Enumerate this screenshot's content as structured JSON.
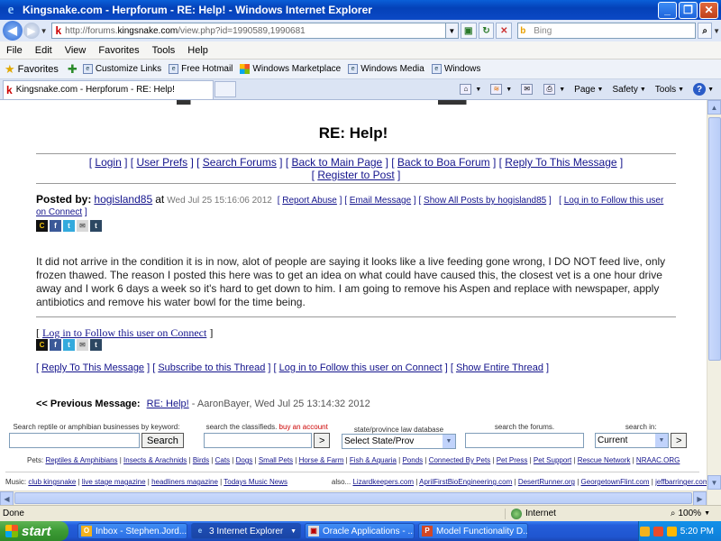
{
  "window": {
    "title": "Kingsnake.com - Herpforum - RE: Help! - Windows Internet Explorer"
  },
  "address": {
    "prefix": "http://forums.",
    "domain": "kingsnake.com",
    "path": "/view.php?id=1990589,1990681"
  },
  "search": {
    "placeholder": "Bing"
  },
  "menu": [
    "File",
    "Edit",
    "View",
    "Favorites",
    "Tools",
    "Help"
  ],
  "favorites": {
    "label": "Favorites",
    "links": [
      "Customize Links",
      "Free Hotmail",
      "Windows Marketplace",
      "Windows Media",
      "Windows"
    ]
  },
  "tab": {
    "title": "Kingsnake.com - Herpforum - RE: Help!"
  },
  "commands": {
    "page": "Page",
    "safety": "Safety",
    "tools": "Tools"
  },
  "content": {
    "title": "RE: Help!",
    "nav": {
      "login": "Login",
      "prefs": "User Prefs",
      "search": "Search Forums",
      "main": "Back to Main Page",
      "boa": "Back to Boa Forum",
      "reply": "Reply To This Message",
      "register": "Register to Post"
    },
    "post": {
      "posted_by": "Posted by:",
      "author": "hogisland85",
      "at": "at",
      "date": "Wed Jul 25 15:16:06 2012",
      "report": "Report Abuse",
      "email": "Email Message",
      "showall": "Show All Posts by hogisland85",
      "follow": "Log in to Follow this user on Connect",
      "body": "It did not arrive in the condition it is in now, alot of people are saying it looks like a live feeding gone wrong, I DO NOT feed live, only frozen thawed. The reason I posted this here was to get an idea on what could have caused this, the closest vet is a one hour drive away and I work 6 days a week so it's hard to get down to him. I am going to remove his Aspen and replace with newspaper, apply antibiotics and remove his water bowl for the time being."
    },
    "follow2": "Log in to Follow this user on Connect",
    "actions": {
      "reply": "Reply To This Message",
      "subscribe": "Subscribe to this Thread",
      "follow": "Log in to Follow this user on Connect",
      "thread": "Show Entire Thread"
    },
    "prev": {
      "label": "<< Previous Message:",
      "link": "RE: Help!",
      "meta": "- AaronBayer, Wed Jul 25 13:14:32 2012"
    },
    "forms": {
      "reptile_label": "Search reptile or amphibian businesses by keyword:",
      "reptile_btn": "Search",
      "classified_label": "search the classifieds.",
      "buy": "buy an account",
      "gt": ">",
      "law_label": "state/province law database",
      "state_sel": "Select State/Prov",
      "forums_label": "search the forums.",
      "searchin_label": "search in:",
      "current_sel": "Current"
    },
    "pets": {
      "label": "Pets:",
      "links": [
        "Reptiles & Amphibians",
        "Insects & Arachnids",
        "Birds",
        "Cats",
        "Dogs",
        "Small Pets",
        "Horse & Farm",
        "Fish & Aquaria",
        "Ponds",
        "Connected By Pets",
        "Pet Press",
        "Pet Support",
        "Rescue Network",
        "NRAAC.ORG"
      ]
    },
    "music": {
      "label": "Music:",
      "links": [
        "club kingsnake",
        "live stage magazine",
        "headliners magazine",
        "Todays Music News"
      ],
      "also": "also...",
      "also_links": [
        "Lizardkeepers.com",
        "AprilFirstBioEngineering.com",
        "DesertRunner.org",
        "GeorgetownFlint.com",
        "jeffbarringer.com"
      ]
    }
  },
  "status": {
    "text": "Done",
    "zone": "Internet",
    "zoom": "100%"
  },
  "taskbar": {
    "start": "start",
    "items": [
      "Inbox - Stephen.Jord...",
      "3 Internet Explorer",
      "Oracle Applications - ...",
      "Model Functionality D..."
    ],
    "clock": "5:20 PM"
  }
}
